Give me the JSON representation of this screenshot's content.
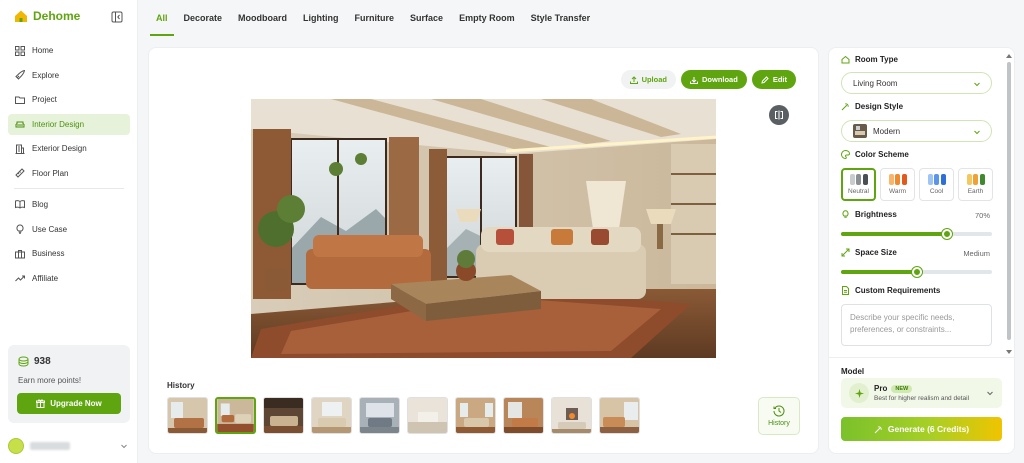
{
  "brand": {
    "name": "Dehome",
    "accent": "#5fa510"
  },
  "sidebar": {
    "items": [
      {
        "label": "Home",
        "icon": "grid-icon"
      },
      {
        "label": "Explore",
        "icon": "rocket-icon"
      },
      {
        "label": "Project",
        "icon": "folder-icon"
      },
      {
        "label": "Interior Design",
        "icon": "sofa-icon",
        "active": true
      },
      {
        "label": "Exterior Design",
        "icon": "building-icon"
      },
      {
        "label": "Floor Plan",
        "icon": "ruler-icon"
      }
    ],
    "items2": [
      {
        "label": "Blog",
        "icon": "book-icon"
      },
      {
        "label": "Use Case",
        "icon": "bulb-icon"
      },
      {
        "label": "Business",
        "icon": "briefcase-icon"
      },
      {
        "label": "Affiliate",
        "icon": "trend-icon"
      }
    ],
    "points": {
      "value": "938",
      "subtitle": "Earn more points!",
      "upgrade_label": "Upgrade Now"
    }
  },
  "tabs": [
    "All",
    "Decorate",
    "Moodboard",
    "Lighting",
    "Furniture",
    "Surface",
    "Empty Room",
    "Style Transfer"
  ],
  "main": {
    "actions": {
      "upload": "Upload",
      "download": "Download",
      "edit": "Edit"
    },
    "history_label": "History",
    "history_button": "History",
    "history_count": 10,
    "history_selected": 1
  },
  "panel": {
    "room_type": {
      "label": "Room Type",
      "value": "Living Room"
    },
    "design_style": {
      "label": "Design Style",
      "value": "Modern"
    },
    "color_scheme": {
      "label": "Color Scheme",
      "options": [
        {
          "name": "Neutral",
          "colors": [
            "#c9ccce",
            "#8a8f93",
            "#4a4f53"
          ],
          "selected": true
        },
        {
          "name": "Warm",
          "colors": [
            "#f7b66b",
            "#f08a2c",
            "#e3581b"
          ]
        },
        {
          "name": "Cool",
          "colors": [
            "#9ec5f5",
            "#5b95ea",
            "#2f6fd8"
          ]
        },
        {
          "name": "Earth",
          "colors": [
            "#f4c860",
            "#f0a136",
            "#3f8a2f"
          ]
        }
      ]
    },
    "brightness": {
      "label": "Brightness",
      "value": "70%",
      "level": 0.7
    },
    "space_size": {
      "label": "Space Size",
      "value": "Medium",
      "level": 0.5
    },
    "custom": {
      "label": "Custom Requirements",
      "placeholder": "Describe your specific needs, preferences, or constraints..."
    },
    "model": {
      "label": "Model",
      "name": "Pro",
      "badge": "NEW",
      "desc": "Best for higher realism and detail"
    },
    "generate_label": "Generate (6 Credits)"
  }
}
